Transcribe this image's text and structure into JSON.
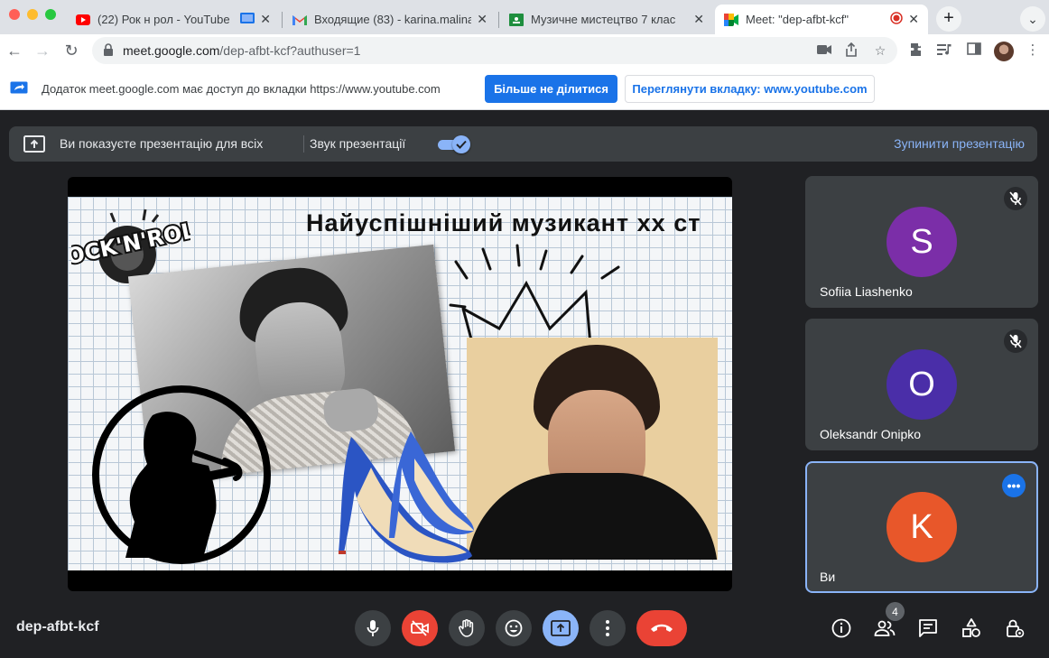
{
  "browser": {
    "tabs": [
      {
        "title": "(22) Рок н рол - YouTube",
        "icon": "youtube-icon"
      },
      {
        "title": "Входящие (83) - karina.malina",
        "icon": "gmail-icon"
      },
      {
        "title": "Музичне мистецтво 7 клас",
        "icon": "classroom-icon"
      },
      {
        "title": "Meet: \"dep-afbt-kcf\"",
        "icon": "meet-icon"
      }
    ],
    "new_tab_label": "+",
    "address": {
      "host": "meet.google.com",
      "path": "/dep-afbt-kcf?authuser=1"
    }
  },
  "infobar": {
    "message": "Додаток meet.google.com має доступ до вкладки https://www.youtube.com",
    "stop_sharing": "Більше не ділитися",
    "view_tab": "Переглянути вкладку: www.youtube.com"
  },
  "presenting": {
    "message": "Ви показуєте презентацію для всіх",
    "audio_label": "Звук презентації",
    "audio_enabled": true,
    "stop_label": "Зупинити презентацію"
  },
  "slide": {
    "title": "Найуспішніший музикант хх ст",
    "logo_text": "ROCK'N'ROLL"
  },
  "participants": [
    {
      "initial": "S",
      "name": "Sofiia Liashenko",
      "color": "#7b2ea8",
      "muted": true
    },
    {
      "initial": "O",
      "name": "Oleksandr Onipko",
      "color": "#4a2ea8",
      "muted": true
    },
    {
      "initial": "K",
      "name": "Ви",
      "color": "#e8572a",
      "muted": false
    }
  ],
  "meeting_code": "dep-afbt-kcf",
  "people_count": "4",
  "colors": {
    "accent": "#1a73e8",
    "light_accent": "#8ab4f8",
    "danger": "#ea4335",
    "surface": "#3c4043",
    "background": "#202124"
  }
}
